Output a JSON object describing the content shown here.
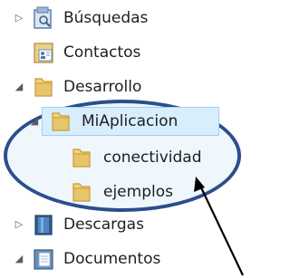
{
  "tree": {
    "items": [
      {
        "label": "Búsquedas",
        "icon": "saved-search-icon",
        "expander": "collapsed"
      },
      {
        "label": "Contactos",
        "icon": "contacts-folder-icon",
        "expander": "none"
      },
      {
        "label": "Desarrollo",
        "icon": "folder-icon",
        "expander": "expanded"
      },
      {
        "label": "MiAplicacion",
        "icon": "folder-icon",
        "expander": "expanded",
        "selected": true
      },
      {
        "label": "conectividad",
        "icon": "folder-icon",
        "expander": "none"
      },
      {
        "label": "ejemplos",
        "icon": "folder-icon",
        "expander": "none"
      },
      {
        "label": "Descargas",
        "icon": "downloads-folder-icon",
        "expander": "collapsed"
      },
      {
        "label": "Documentos",
        "icon": "documents-library-icon",
        "expander": "expanded"
      }
    ]
  },
  "colors": {
    "selection_fill": "#d8eefc",
    "selection_border": "#99d1f5",
    "annotation": "#2b4e8c",
    "folder": "#e8c46a"
  }
}
